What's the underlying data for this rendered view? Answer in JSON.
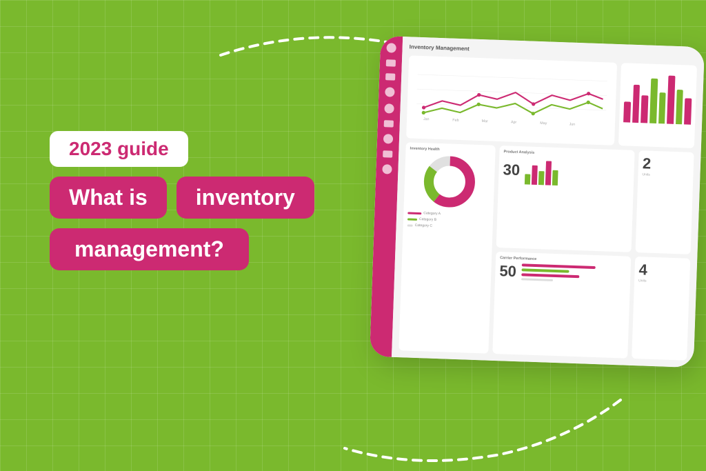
{
  "background": {
    "color": "#7ab92d"
  },
  "left_content": {
    "badge_guide": "2023 guide",
    "text_what_is": "What is",
    "text_inventory": "inventory",
    "text_management": "management?"
  },
  "dashboard": {
    "title": "Inventory Management",
    "sidebar_icons": [
      "user",
      "search",
      "chart",
      "message",
      "at",
      "phone",
      "mail",
      "navigation",
      "person"
    ],
    "panels": {
      "inventory_health": "Inventory Health",
      "product_analysis": "Product Analysis",
      "product_value": "30",
      "carrier_performance": "Carrier Performance",
      "carrier_value": "50",
      "other_value": "2",
      "other_value2": "4"
    }
  },
  "dashes": {
    "color": "white"
  }
}
